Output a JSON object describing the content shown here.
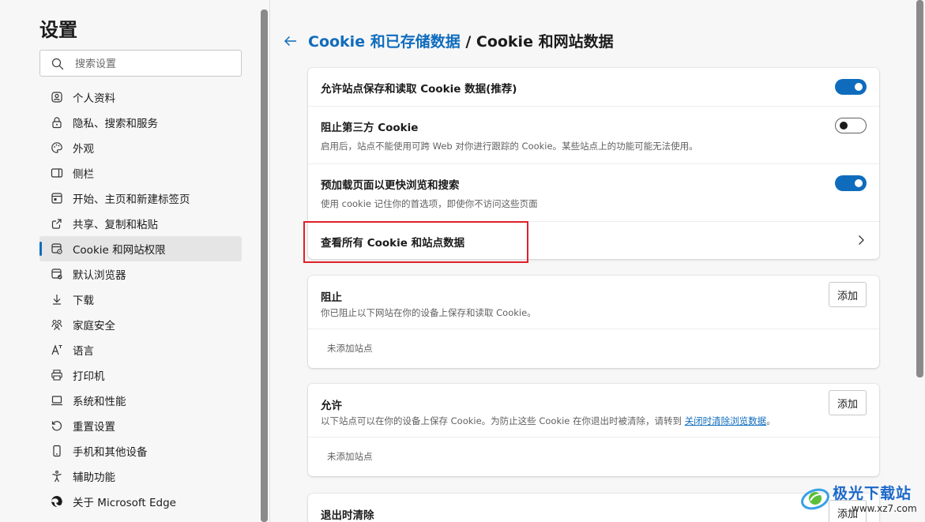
{
  "sidebar": {
    "title": "设置",
    "search_placeholder": "搜索设置",
    "items": [
      {
        "label": "个人资料",
        "icon": "profile-icon"
      },
      {
        "label": "隐私、搜索和服务",
        "icon": "lock-icon"
      },
      {
        "label": "外观",
        "icon": "palette-icon"
      },
      {
        "label": "侧栏",
        "icon": "sidebar-icon"
      },
      {
        "label": "开始、主页和新建标签页",
        "icon": "home-tabs-icon"
      },
      {
        "label": "共享、复制和粘贴",
        "icon": "share-icon"
      },
      {
        "label": "Cookie 和网站权限",
        "icon": "cookie-settings-icon",
        "active": true
      },
      {
        "label": "默认浏览器",
        "icon": "browser-icon"
      },
      {
        "label": "下载",
        "icon": "download-icon"
      },
      {
        "label": "家庭安全",
        "icon": "family-icon"
      },
      {
        "label": "语言",
        "icon": "language-icon"
      },
      {
        "label": "打印机",
        "icon": "printer-icon"
      },
      {
        "label": "系统和性能",
        "icon": "laptop-icon"
      },
      {
        "label": "重置设置",
        "icon": "reset-icon"
      },
      {
        "label": "手机和其他设备",
        "icon": "phone-icon"
      },
      {
        "label": "辅助功能",
        "icon": "accessibility-icon"
      },
      {
        "label": "关于 Microsoft Edge",
        "icon": "edge-icon"
      }
    ]
  },
  "header": {
    "breadcrumb_link": "Cookie 和已存储数据",
    "separator": " / ",
    "title": "Cookie 和网站数据"
  },
  "settings": {
    "allow_cookies": {
      "title": "允许站点保存和读取 Cookie 数据(推荐)",
      "enabled": true
    },
    "block_third_party": {
      "title": "阻止第三方 Cookie",
      "desc": "启用后，站点不能使用可跨 Web 对你进行跟踪的 Cookie。某些站点上的功能可能无法使用。",
      "enabled": false
    },
    "preload": {
      "title": "预加载页面以更快浏览和搜索",
      "desc": "使用 cookie 记住你的首选项，即使你不访问这些页面",
      "enabled": true
    },
    "see_all": {
      "title": "查看所有 Cookie 和站点数据"
    }
  },
  "block_section": {
    "title": "阻止",
    "desc": "你已阻止以下网站在你的设备上保存和读取 Cookie。",
    "add_label": "添加",
    "empty": "未添加站点"
  },
  "allow_section": {
    "title": "允许",
    "desc_before": "以下站点可以在你的设备上保存 Cookie。为防止这些 Cookie 在你退出时被清除，请转到 ",
    "desc_link": "关闭时清除浏览数据",
    "desc_after": "。",
    "add_label": "添加",
    "empty": "未添加站点"
  },
  "clear_on_exit_section": {
    "title": "退出时清除",
    "add_label": "添加"
  },
  "watermark": {
    "brand": "极光下载站",
    "url": "www.xz7.com"
  },
  "colors": {
    "accent": "#0f6cbd",
    "highlight": "#e0202a"
  }
}
